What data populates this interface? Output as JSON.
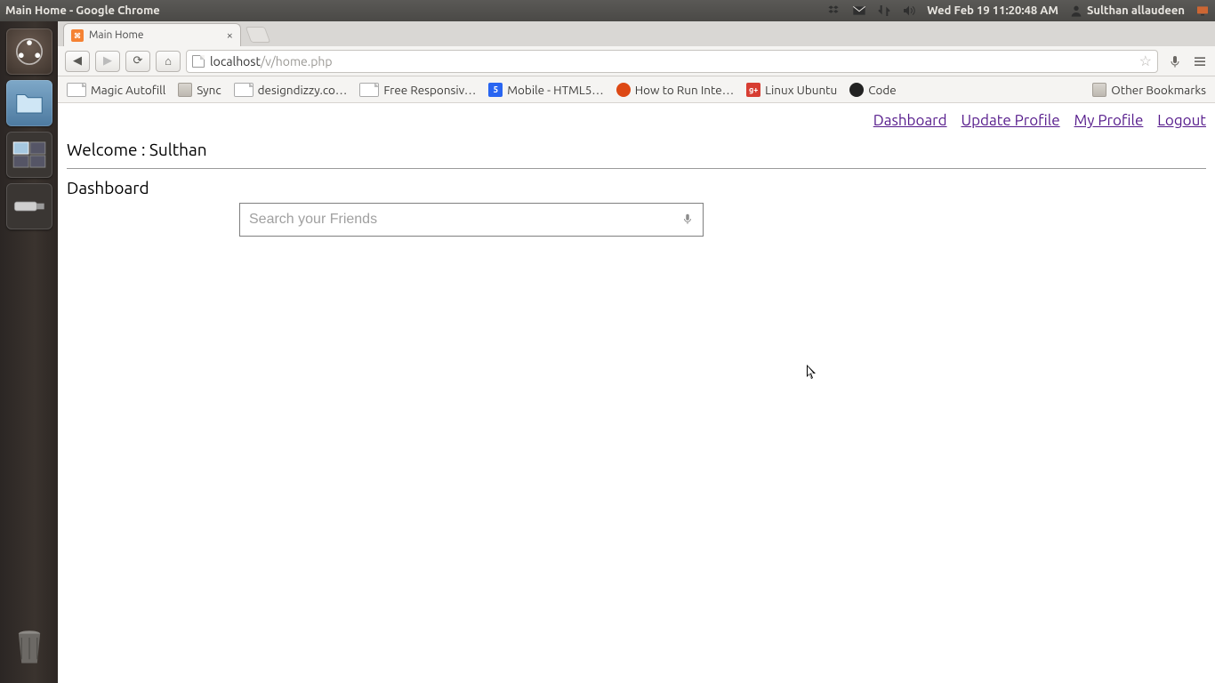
{
  "menubar": {
    "window_title": "Main Home - Google Chrome",
    "datetime": "Wed Feb 19 11:20:48 AM",
    "username": "Sulthan allaudeen"
  },
  "launcher": {
    "items": [
      "ubuntu-dash",
      "files",
      "chrome",
      "workspace-switcher",
      "usb-drive"
    ],
    "trash": "trash"
  },
  "chrome": {
    "tab": {
      "title": "Main Home"
    },
    "url_host": "localhost",
    "url_path": "/v/home.php",
    "nav": {
      "back": "◀",
      "forward": "▶",
      "reload": "⟳",
      "home": "⌂"
    },
    "bookmarks": [
      {
        "icon": "page",
        "label": "Magic Autofill"
      },
      {
        "icon": "folder",
        "label": "Sync"
      },
      {
        "icon": "page",
        "label": "designdizzy.co…"
      },
      {
        "icon": "page",
        "label": "Free Responsiv…"
      },
      {
        "icon": "html5",
        "label": "Mobile - HTML5…"
      },
      {
        "icon": "ubuntu",
        "label": "How to Run Inte…"
      },
      {
        "icon": "gplus",
        "label": "Linux Ubuntu"
      },
      {
        "icon": "gh",
        "label": "Code"
      }
    ],
    "other_bookmarks": "Other Bookmarks"
  },
  "page": {
    "links": {
      "dashboard": "Dashboard",
      "update_profile": "Update Profile",
      "my_profile": "My Profile",
      "logout": "Logout"
    },
    "welcome_prefix": "Welcome : ",
    "welcome_name": "Sulthan",
    "section_title": "Dashboard",
    "search_placeholder": "Search your Friends"
  }
}
